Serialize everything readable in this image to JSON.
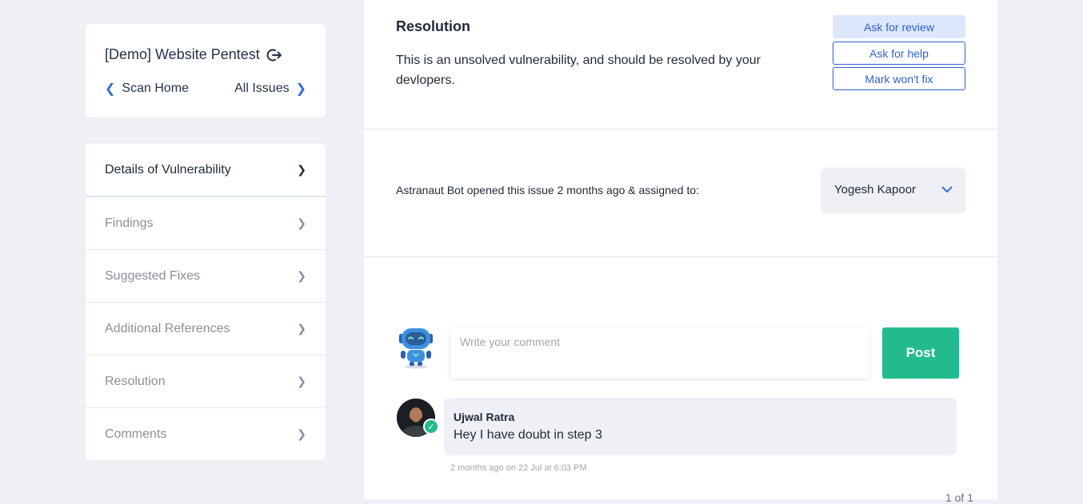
{
  "scan": {
    "title": "[Demo] Website Pentest",
    "back_label": "Scan Home",
    "all_issues_label": "All Issues"
  },
  "menu": {
    "items": [
      {
        "label": "Details of Vulnerability",
        "active": true
      },
      {
        "label": "Findings",
        "active": false
      },
      {
        "label": "Suggested Fixes",
        "active": false
      },
      {
        "label": "Additional References",
        "active": false
      },
      {
        "label": "Resolution",
        "active": false
      },
      {
        "label": "Comments",
        "active": false
      }
    ]
  },
  "resolution": {
    "heading": "Resolution",
    "text": "This is an unsolved vulnerability, and should be resolved by your devlopers.",
    "buttons": {
      "review": "Ask for review",
      "help": "Ask for help",
      "wontfix": "Mark won't fix"
    }
  },
  "assignment": {
    "text": "Astranaut Bot opened this issue 2 months ago & assigned to:",
    "assignee": "Yogesh Kapoor"
  },
  "comments": {
    "placeholder": "Write your comment",
    "post_label": "Post",
    "items": [
      {
        "author": "Ujwal Ratra",
        "body": "Hey I have doubt in step 3",
        "time": "2 months ago on 22 Jul at 6:03 PM"
      }
    ],
    "pager": "1 of 1"
  },
  "colors": {
    "accent_blue": "#2f5fcf",
    "post_green": "#23bb8d",
    "page_bg": "#eef0f5"
  },
  "icons": {
    "exit": "exit-icon",
    "back": "chevron-left-icon",
    "forward": "chevron-right-icon",
    "dropdown": "chevron-down-icon",
    "verified": "check-icon"
  }
}
